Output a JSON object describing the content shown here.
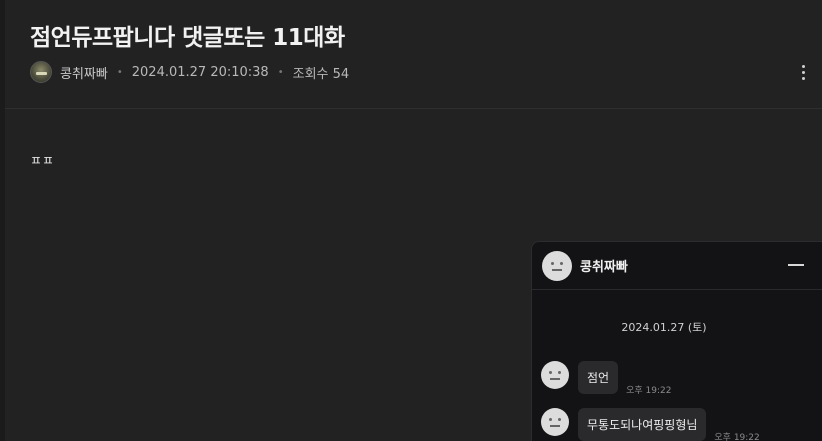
{
  "post": {
    "title": "점언듀프팝니다 댓글또는 11대화",
    "author": "콩취짜빠",
    "datetime": "2024.01.27 20:10:38",
    "views": "조회수 54",
    "body": "ㅍㅍ"
  },
  "chat": {
    "name": "콩취짜빠",
    "date": "2024.01.27 (토)",
    "messages": [
      {
        "text": "점언",
        "time": "오후 19:22"
      },
      {
        "text": "무통도되나여핑핑형님",
        "time": "오후 19:22"
      }
    ]
  },
  "icons": {
    "more": "more-vertical-icon",
    "minimize": "minimize-icon",
    "avatar": "default-face-icon"
  },
  "colors": {
    "background": "#222222",
    "chat_background": "#131316",
    "bubble": "#2a2a2d"
  }
}
